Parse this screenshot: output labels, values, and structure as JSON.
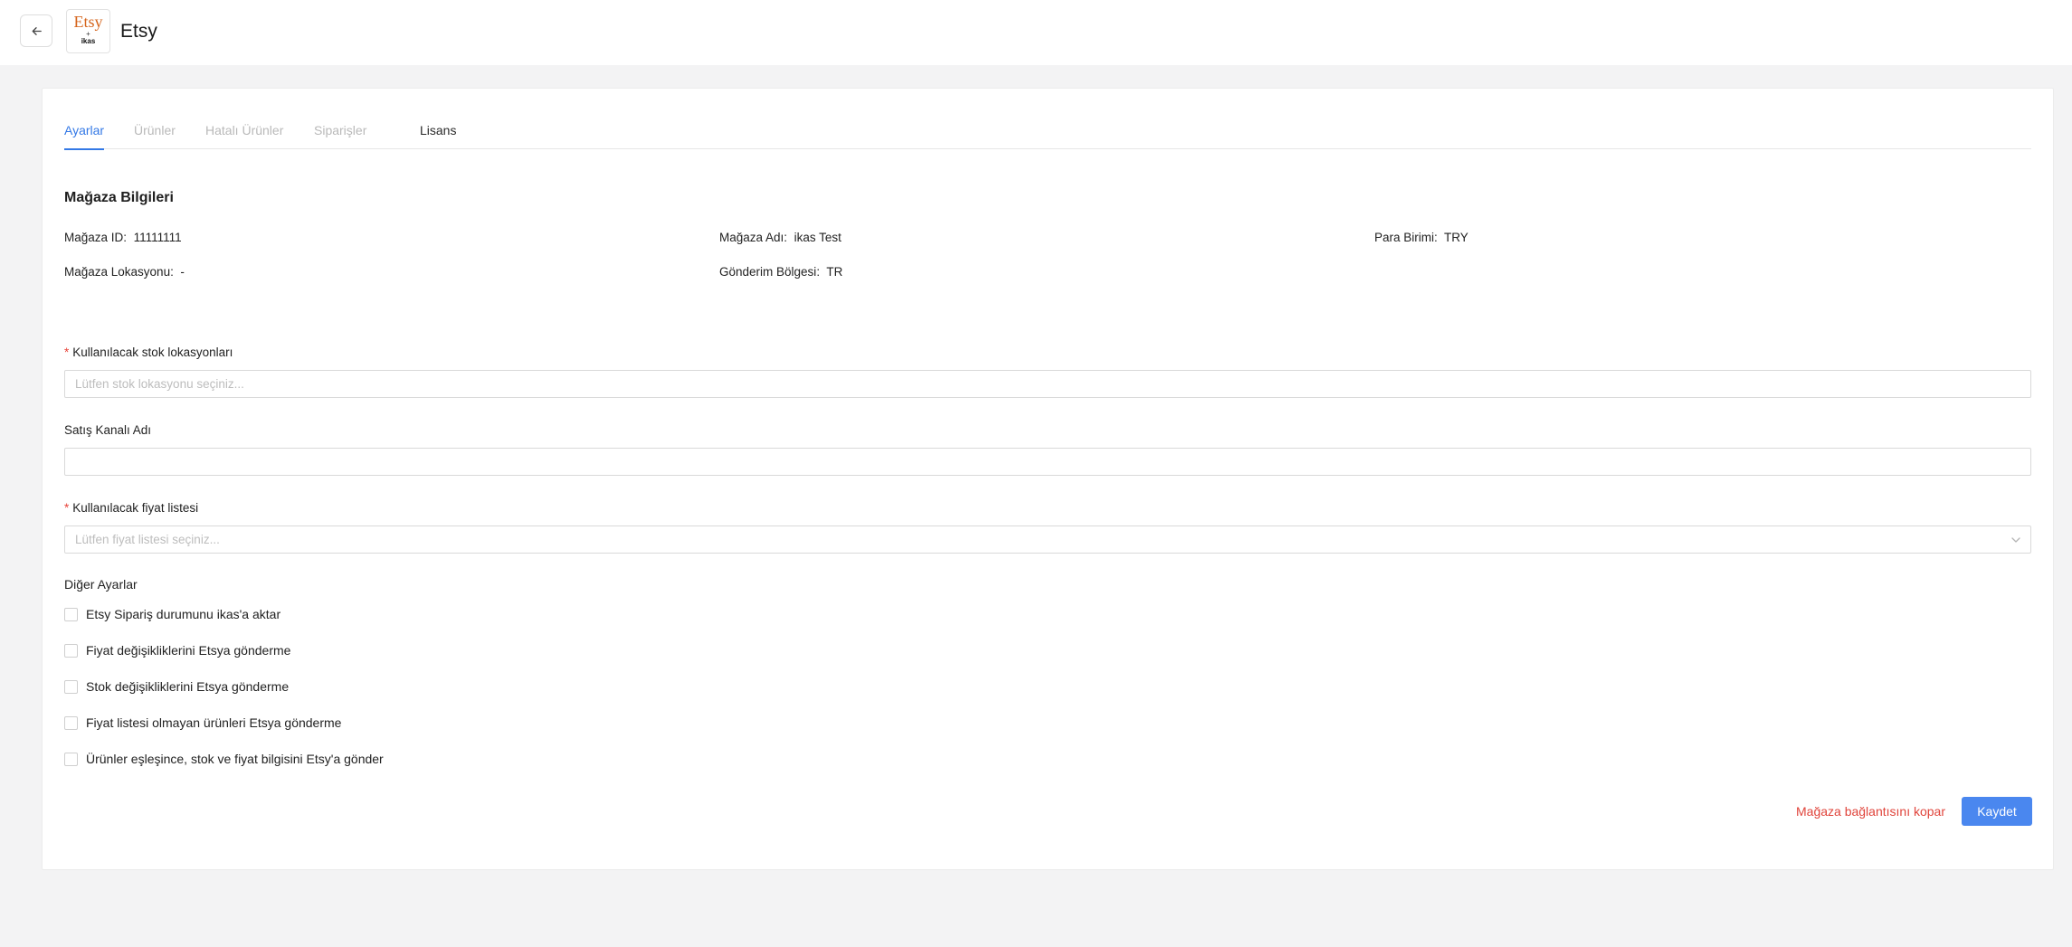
{
  "header": {
    "title": "Etsy",
    "logo": {
      "main": "Etsy",
      "plus": "+",
      "sub": "ikas"
    },
    "back_icon": "arrow-left-icon"
  },
  "tabs": [
    {
      "label": "Ayarlar",
      "state": "active"
    },
    {
      "label": "Ürünler",
      "state": "disabled"
    },
    {
      "label": "Hatalı Ürünler",
      "state": "disabled"
    },
    {
      "label": "Siparişler",
      "state": "disabled"
    },
    {
      "label": "Lisans",
      "state": "normal"
    }
  ],
  "store_info": {
    "title": "Mağaza Bilgileri",
    "store_id_label": "Mağaza ID",
    "store_id_value": "11111111",
    "store_name_label": "Mağaza Adı",
    "store_name_value": "ikas Test",
    "currency_label": "Para Birimi",
    "currency_value": "TRY",
    "location_label": "Mağaza Lokasyonu",
    "location_value": "-",
    "shipping_label": "Gönderim Bölgesi",
    "shipping_value": "TR",
    "separator": ":"
  },
  "form": {
    "required_mark": "*",
    "stock_locations_label": "Kullanılacak stok lokasyonları",
    "stock_locations_placeholder": "Lütfen stok lokasyonu seçiniz...",
    "sales_channel_label": "Satış Kanalı Adı",
    "sales_channel_value": "",
    "price_list_label": "Kullanılacak fiyat listesi",
    "price_list_placeholder": "Lütfen fiyat listesi seçiniz...",
    "other_settings_title": "Diğer Ayarlar",
    "checkboxes": [
      "Etsy Sipariş durumunu ikas'a aktar",
      "Fiyat değişikliklerini Etsya gönderme",
      "Stok değişikliklerini Etsya gönderme",
      "Fiyat listesi olmayan ürünleri Etsya gönderme",
      "Ürünler eşleşince, stok ve fiyat bilgisini Etsy'a gönder"
    ]
  },
  "actions": {
    "disconnect_label": "Mağaza bağlantısını kopar",
    "save_label": "Kaydet"
  },
  "colors": {
    "accent": "#3479e6",
    "save_button": "#4a87ef",
    "danger": "#e0443b",
    "etsy_orange": "#d5641c"
  }
}
